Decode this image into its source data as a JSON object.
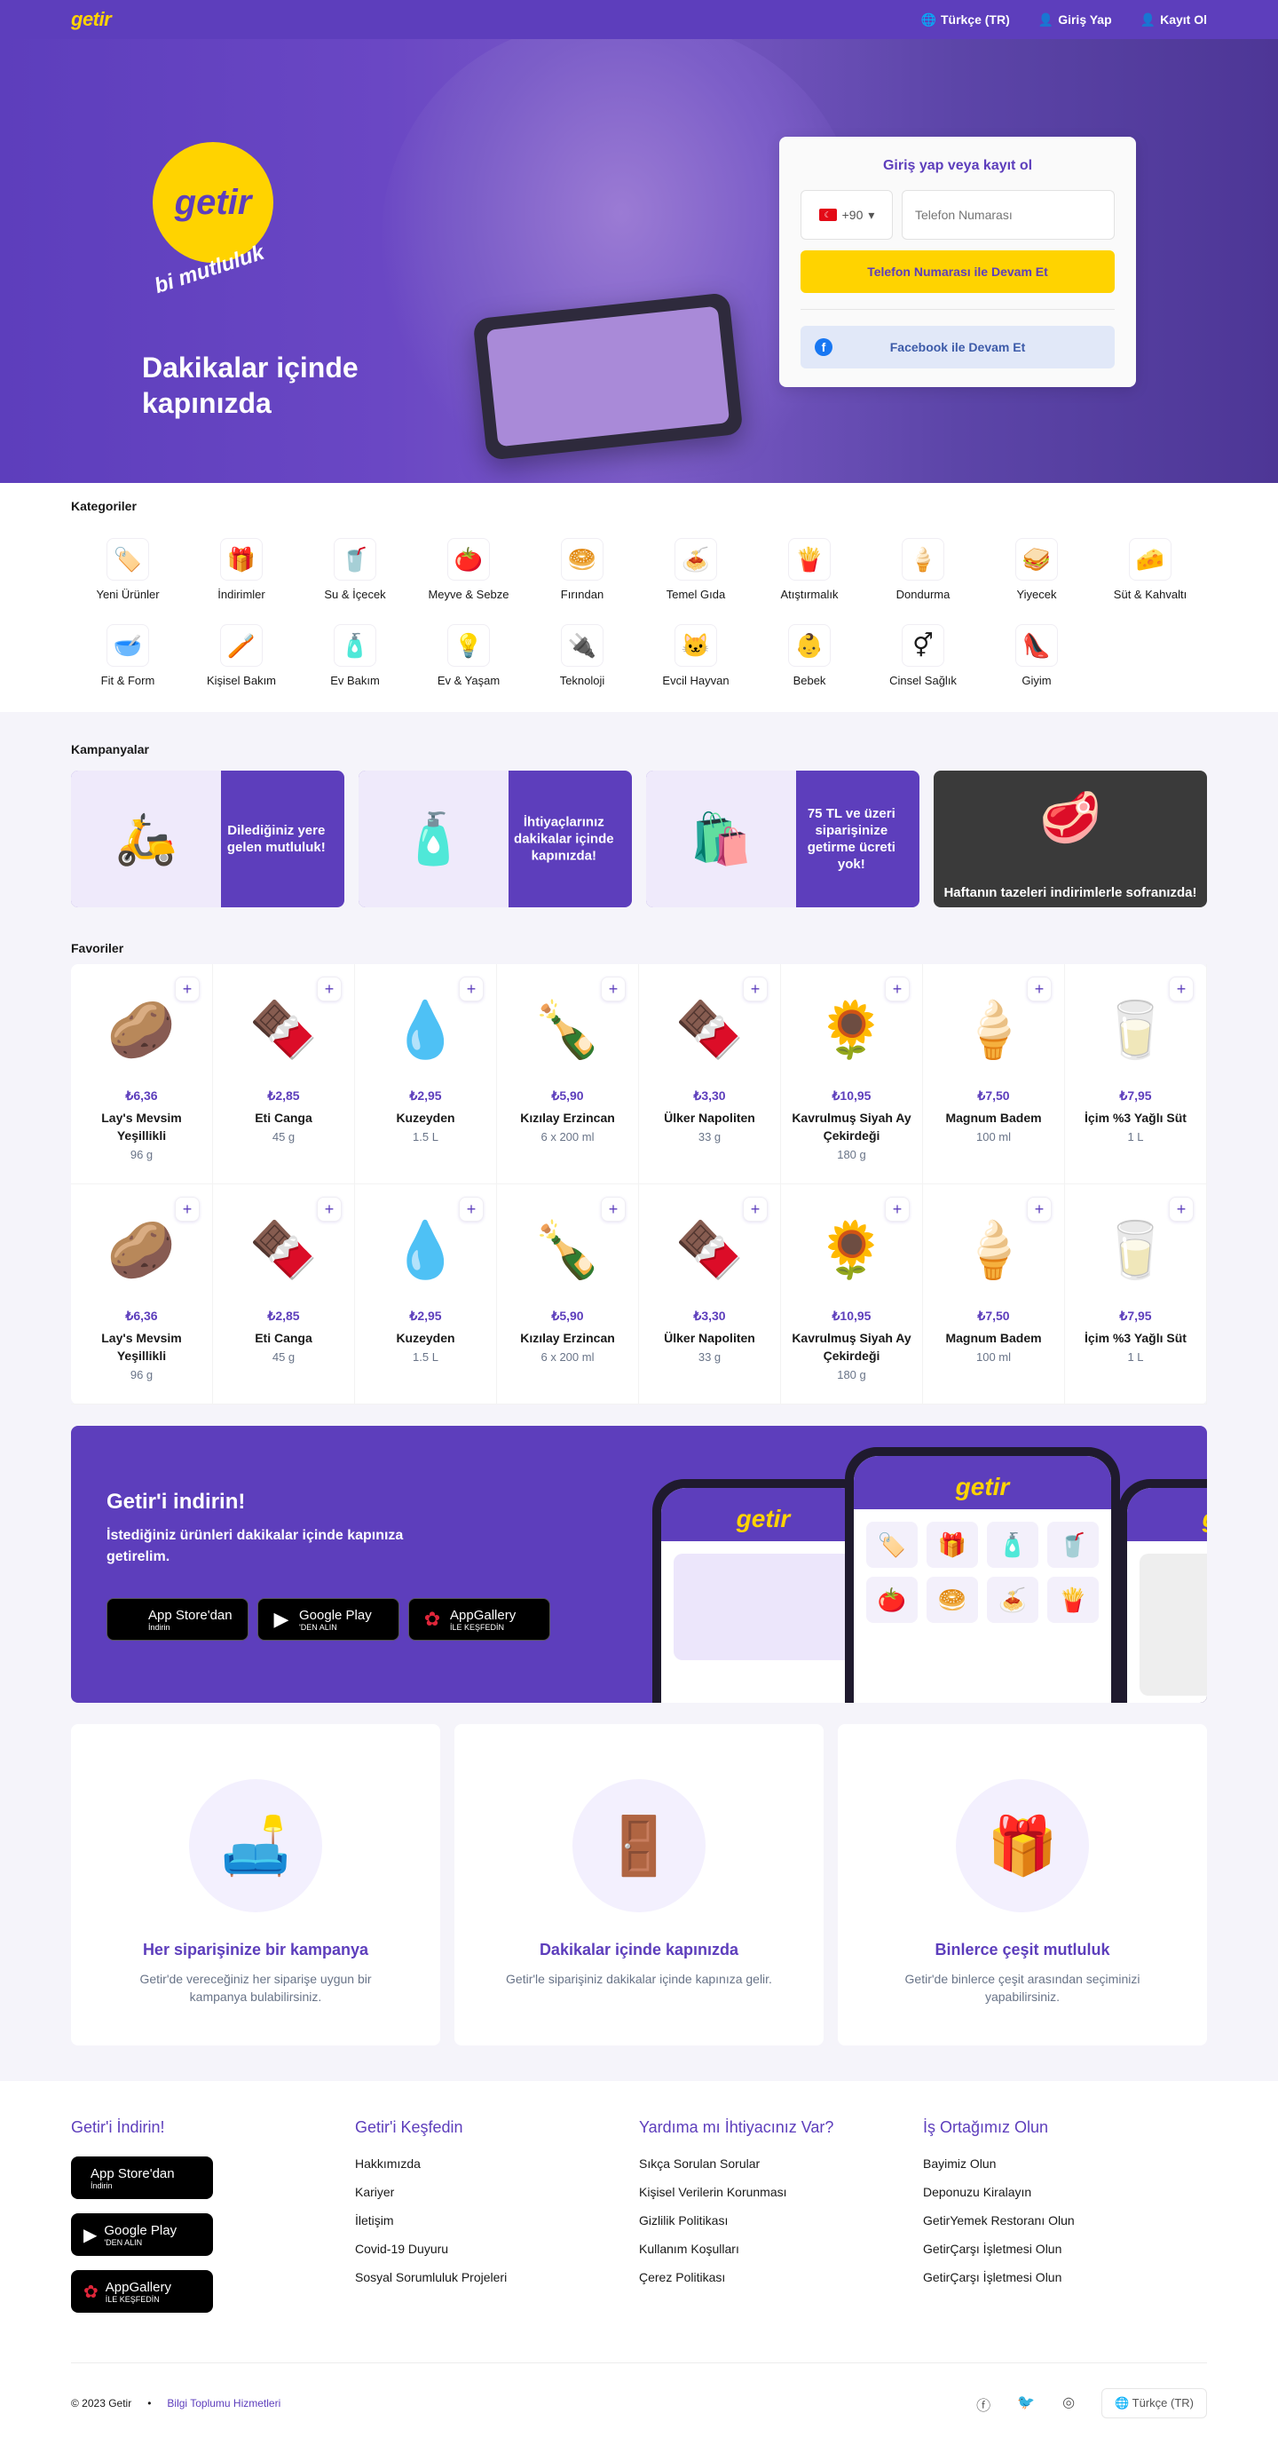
{
  "topbar": {
    "logo": "getir",
    "language": "Türkçe (TR)",
    "login": "Giriş Yap",
    "register": "Kayıt Ol"
  },
  "hero": {
    "logo": "getir",
    "slogan": "bi mutluluk",
    "title": "Dakikalar içinde kapınızda"
  },
  "login_box": {
    "title": "Giriş yap veya kayıt ol",
    "country_code": "+90",
    "phone_placeholder": "Telefon Numarası",
    "phone_button": "Telefon Numarası ile Devam Et",
    "facebook_button": "Facebook ile Devam Et"
  },
  "categories": {
    "title": "Kategoriler",
    "items": [
      {
        "label": "Yeni Ürünler",
        "icon": "🏷️"
      },
      {
        "label": "İndirimler",
        "icon": "🎁"
      },
      {
        "label": "Su & İçecek",
        "icon": "🥤"
      },
      {
        "label": "Meyve & Sebze",
        "icon": "🍅"
      },
      {
        "label": "Fırından",
        "icon": "🥯"
      },
      {
        "label": "Temel Gıda",
        "icon": "🍝"
      },
      {
        "label": "Atıştırmalık",
        "icon": "🍟"
      },
      {
        "label": "Dondurma",
        "icon": "🍦"
      },
      {
        "label": "Yiyecek",
        "icon": "🥪"
      },
      {
        "label": "Süt & Kahvaltı",
        "icon": "🧀"
      },
      {
        "label": "Fit & Form",
        "icon": "🥣"
      },
      {
        "label": "Kişisel Bakım",
        "icon": "🪥"
      },
      {
        "label": "Ev Bakım",
        "icon": "🧴"
      },
      {
        "label": "Ev & Yaşam",
        "icon": "💡"
      },
      {
        "label": "Teknoloji",
        "icon": "🔌"
      },
      {
        "label": "Evcil Hayvan",
        "icon": "🐱"
      },
      {
        "label": "Bebek",
        "icon": "👶"
      },
      {
        "label": "Cinsel Sağlık",
        "icon": "⚥"
      },
      {
        "label": "Giyim",
        "icon": "👠"
      }
    ]
  },
  "campaigns": {
    "title": "Kampanyalar",
    "items": [
      {
        "text": "Dilediğiniz yere gelen mutluluk!",
        "icon": "🛵"
      },
      {
        "text": "İhtiyaçlarınız dakikalar içinde kapınızda!",
        "icon": "🧴"
      },
      {
        "text": "75 TL ve üzeri siparişinize getirme ücreti yok!",
        "icon": "🛍️"
      },
      {
        "text": "Haftanın tazeleri indirimlerle sofranızda!",
        "icon": "🥩"
      }
    ]
  },
  "favorites": {
    "title": "Favoriler",
    "items": [
      {
        "price": "₺6,36",
        "name": "Lay's Mevsim Yeşillikli",
        "desc": "96 g",
        "icon": "🥔"
      },
      {
        "price": "₺2,85",
        "name": "Eti Canga",
        "desc": "45 g",
        "icon": "🍫"
      },
      {
        "price": "₺2,95",
        "name": "Kuzeyden",
        "desc": "1.5 L",
        "icon": "💧"
      },
      {
        "price": "₺5,90",
        "name": "Kızılay Erzincan",
        "desc": "6 x 200 ml",
        "icon": "🍾"
      },
      {
        "price": "₺3,30",
        "name": "Ülker Napoliten",
        "desc": "33 g",
        "icon": "🍫"
      },
      {
        "price": "₺10,95",
        "name": "Kavrulmuş Siyah Ay Çekirdeği",
        "desc": "180 g",
        "icon": "🌻"
      },
      {
        "price": "₺7,50",
        "name": "Magnum Badem",
        "desc": "100 ml",
        "icon": "🍦"
      },
      {
        "price": "₺7,95",
        "name": "İçim %3 Yağlı Süt",
        "desc": "1 L",
        "icon": "🥛"
      },
      {
        "price": "₺6,36",
        "name": "Lay's Mevsim Yeşillikli",
        "desc": "96 g",
        "icon": "🥔"
      },
      {
        "price": "₺2,85",
        "name": "Eti Canga",
        "desc": "45 g",
        "icon": "🍫"
      },
      {
        "price": "₺2,95",
        "name": "Kuzeyden",
        "desc": "1.5 L",
        "icon": "💧"
      },
      {
        "price": "₺5,90",
        "name": "Kızılay Erzincan",
        "desc": "6 x 200 ml",
        "icon": "🍾"
      },
      {
        "price": "₺3,30",
        "name": "Ülker Napoliten",
        "desc": "33 g",
        "icon": "🍫"
      },
      {
        "price": "₺10,95",
        "name": "Kavrulmuş Siyah Ay Çekirdeği",
        "desc": "180 g",
        "icon": "🌻"
      },
      {
        "price": "₺7,50",
        "name": "Magnum Badem",
        "desc": "100 ml",
        "icon": "🍦"
      },
      {
        "price": "₺7,95",
        "name": "İçim %3 Yağlı Süt",
        "desc": "1 L",
        "icon": "🥛"
      }
    ]
  },
  "download": {
    "title": "Getir'i indirin!",
    "text": "İstediğiniz ürünleri dakikalar içinde kapınıza getirelim.",
    "app_store": {
      "main": "App Store'dan",
      "sub": "İndirin"
    },
    "google_play": {
      "main": "Google Play",
      "sub": "'DEN ALIN"
    },
    "app_gallery": {
      "main": "AppGallery",
      "sub": "İLE KEŞFEDİN"
    },
    "mock_logo": "getir"
  },
  "features": [
    {
      "title": "Her siparişinize bir kampanya",
      "text": "Getir'de vereceğiniz her siparişe uygun bir kampanya bulabilirsiniz.",
      "icon": "🛋️"
    },
    {
      "title": "Dakikalar içinde kapınızda",
      "text": "Getir'le siparişiniz dakikalar içinde kapınıza gelir.",
      "icon": "🚪"
    },
    {
      "title": "Binlerce çeşit mutluluk",
      "text": "Getir'de binlerce çeşit arasından seçiminizi yapabilirsiniz.",
      "icon": "🎁"
    }
  ],
  "footer": {
    "col1": {
      "title": "Getir'i İndirin!"
    },
    "col2": {
      "title": "Getir'i Keşfedin",
      "links": [
        "Hakkımızda",
        "Kariyer",
        "İletişim",
        "Covid-19 Duyuru",
        "Sosyal Sorumluluk Projeleri"
      ]
    },
    "col3": {
      "title": "Yardıma mı İhtiyacınız Var?",
      "links": [
        "Sıkça Sorulan Sorular",
        "Kişisel Verilerin Korunması",
        "Gizlilik Politikası",
        "Kullanım Koşulları",
        "Çerez Politikası"
      ]
    },
    "col4": {
      "title": "İş Ortağımız Olun",
      "links": [
        "Bayimiz Olun",
        "Deponuzu Kiralayın",
        "GetirYemek Restoranı Olun",
        "GetirÇarşı İşletmesi Olun",
        "GetirÇarşı İşletmesi Olun"
      ]
    },
    "copyright": "© 2023 Getir",
    "info_link": "Bilgi Toplumu Hizmetleri",
    "language": "Türkçe (TR)"
  }
}
